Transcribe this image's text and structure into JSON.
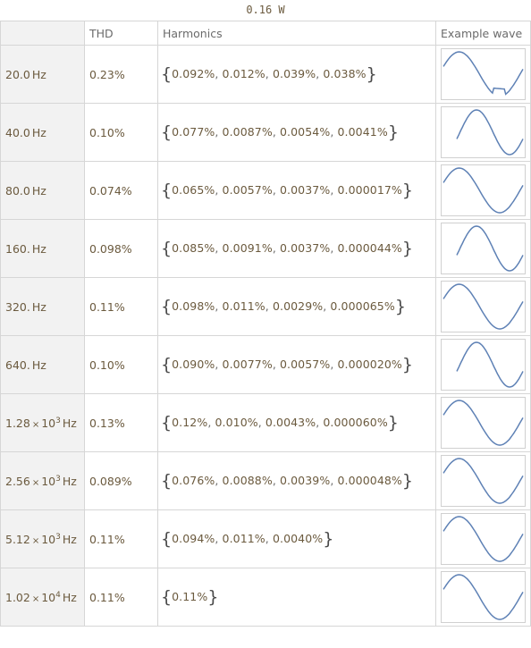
{
  "title": "0.16 W",
  "headers": {
    "thd": "THD",
    "harmonics": "Harmonics",
    "example_wave": "Example wave"
  },
  "rows": [
    {
      "freq": {
        "mantissa": "20.0",
        "exponent": "",
        "unit": "Hz"
      },
      "thd": "0.23%",
      "harmonics": [
        "0.092%",
        "0.012%",
        "0.039%",
        "0.038%"
      ],
      "wave": "clipped-sine"
    },
    {
      "freq": {
        "mantissa": "40.0",
        "exponent": "",
        "unit": "Hz"
      },
      "thd": "0.10%",
      "harmonics": [
        "0.077%",
        "0.0087%",
        "0.0054%",
        "0.0041%"
      ],
      "wave": "sine-offset"
    },
    {
      "freq": {
        "mantissa": "80.0",
        "exponent": "",
        "unit": "Hz"
      },
      "thd": "0.074%",
      "harmonics": [
        "0.065%",
        "0.0057%",
        "0.0037%",
        "0.000017%"
      ],
      "wave": "sine"
    },
    {
      "freq": {
        "mantissa": "160.",
        "exponent": "",
        "unit": "Hz"
      },
      "thd": "0.098%",
      "harmonics": [
        "0.085%",
        "0.0091%",
        "0.0037%",
        "0.000044%"
      ],
      "wave": "sine-offset"
    },
    {
      "freq": {
        "mantissa": "320.",
        "exponent": "",
        "unit": "Hz"
      },
      "thd": "0.11%",
      "harmonics": [
        "0.098%",
        "0.011%",
        "0.0029%",
        "0.000065%"
      ],
      "wave": "sine"
    },
    {
      "freq": {
        "mantissa": "640.",
        "exponent": "",
        "unit": "Hz"
      },
      "thd": "0.10%",
      "harmonics": [
        "0.090%",
        "0.0077%",
        "0.0057%",
        "0.000020%"
      ],
      "wave": "sine-offset"
    },
    {
      "freq": {
        "mantissa": "1.28",
        "exponent": "3",
        "unit": "Hz"
      },
      "thd": "0.13%",
      "harmonics": [
        "0.12%",
        "0.010%",
        "0.0043%",
        "0.000060%"
      ],
      "wave": "sine"
    },
    {
      "freq": {
        "mantissa": "2.56",
        "exponent": "3",
        "unit": "Hz"
      },
      "thd": "0.089%",
      "harmonics": [
        "0.076%",
        "0.0088%",
        "0.0039%",
        "0.000048%"
      ],
      "wave": "sine"
    },
    {
      "freq": {
        "mantissa": "5.12",
        "exponent": "3",
        "unit": "Hz"
      },
      "thd": "0.11%",
      "harmonics": [
        "0.094%",
        "0.011%",
        "0.0040%"
      ],
      "wave": "sine"
    },
    {
      "freq": {
        "mantissa": "1.02",
        "exponent": "4",
        "unit": "Hz"
      },
      "thd": "0.11%",
      "harmonics": [
        "0.11%"
      ],
      "wave": "sine"
    }
  ],
  "colors": {
    "text": "#6b5a3e",
    "header_text": "#6b6b6b",
    "row_header_bg": "#f2f2f2",
    "grid": "#d6d6d6",
    "wave_line": "#5e81b5",
    "wave_frame": "#d0d0d0"
  }
}
